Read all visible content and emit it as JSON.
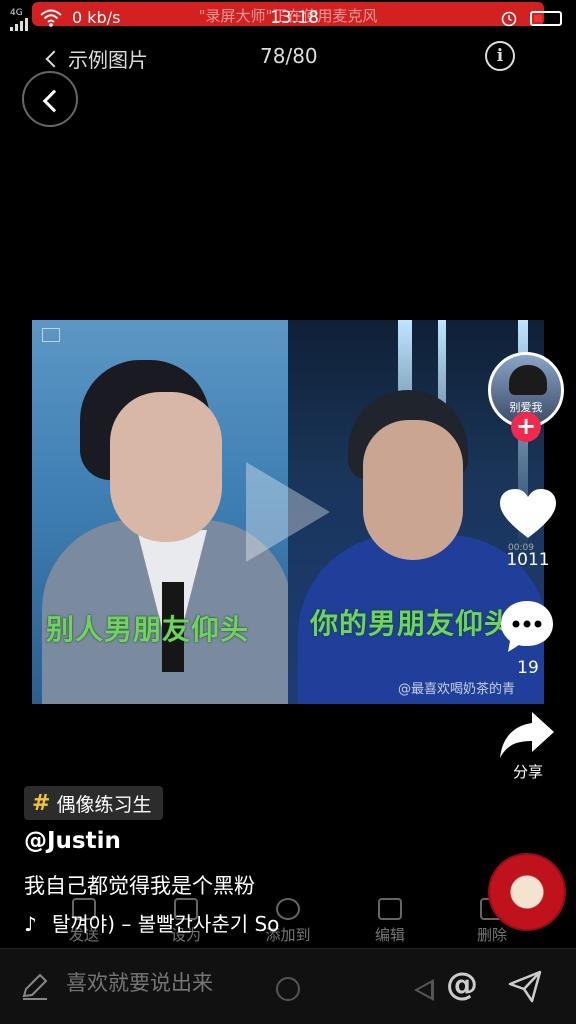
{
  "status_bar": {
    "signal": "4G",
    "speed": "0 kb/s",
    "time": "13:18",
    "recording_banner": "\"录屏大师\"正在使用麦克风"
  },
  "gallery": {
    "back_label": "示例图片",
    "counter": "78/80",
    "info_label": "i"
  },
  "video": {
    "subtitle_left": "别人男朋友仰头",
    "subtitle_right": "你的男朋友仰头",
    "watermark": "@最喜欢喝奶茶的青"
  },
  "rail": {
    "avatar_text": "别爱我",
    "likes": "1011",
    "time_stamp": "00:09",
    "comments": "19",
    "share_label": "分享"
  },
  "caption": {
    "hashtag": "偶像练习生",
    "author": "@Justin",
    "description": "我自己都觉得我是个黑粉",
    "music": "탈껴야) – 볼빨간사춘기  So"
  },
  "ghost_actions": [
    "发送",
    "设为",
    "添加到",
    "编辑",
    "删除"
  ],
  "bottom_bar": {
    "comment_placeholder": "喜欢就要说出来",
    "at_symbol": "@"
  },
  "colors": {
    "accent_red": "#f2294f",
    "recording_red": "#d32020",
    "hashtag_yellow": "#f5c431",
    "subtitle_green": "#6ed35f"
  }
}
